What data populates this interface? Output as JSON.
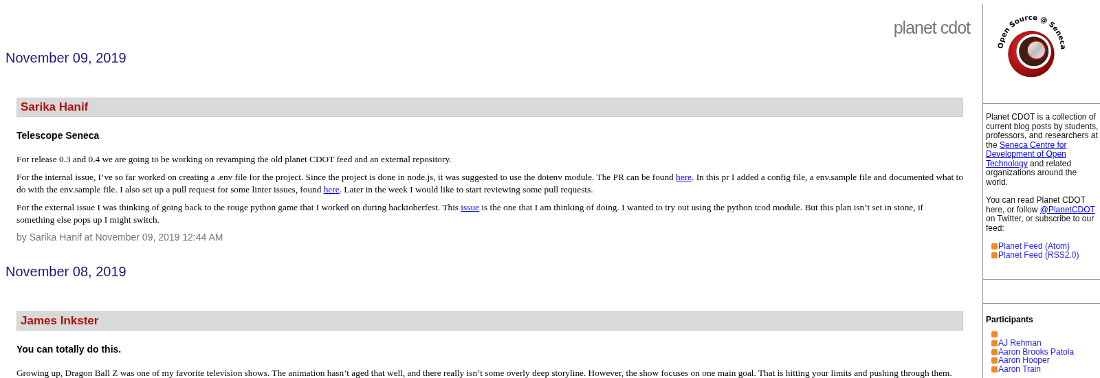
{
  "site_title": "planet cdot",
  "days": [
    {
      "date": "November 09, 2019",
      "posts": [
        {
          "author": "Sarika Hanif",
          "title": "Telescope Seneca",
          "paragraphs": [
            [
              {
                "kind": "text",
                "text": "For release 0.3 and 0.4 we are going to be working on revamping the old planet CDOT feed and an external repository."
              }
            ],
            [
              {
                "kind": "text",
                "text": "For the internal issue, I’ve so far worked on creating a .env file for the project. Since the project is done in node.js, it was suggested to use the dotenv module. The PR can be found "
              },
              {
                "kind": "link",
                "text": "here"
              },
              {
                "kind": "text",
                "text": ". In this pr I added a config file, a env.sample file and documented what to do with the env.sample file. I also set up a pull request for some linter issues, found "
              },
              {
                "kind": "link",
                "text": "here"
              },
              {
                "kind": "text",
                "text": ". Later in the week I would like to start reviewing some pull requests."
              }
            ],
            [
              {
                "kind": "text",
                "text": "For the external issue I was thinking of going back to the rouge python game that I worked on during hacktoberfest. This "
              },
              {
                "kind": "link",
                "text": "issue"
              },
              {
                "kind": "text",
                "text": " is the one that I am thinking of doing. I wanted to try out using the python tcod module. But this plan isn’t set in stone, if something else pops up I might switch."
              }
            ]
          ],
          "byline": "by Sarika Hanif at November 09, 2019 12:44 AM"
        }
      ]
    },
    {
      "date": "November 08, 2019",
      "posts": [
        {
          "author": "James Inkster",
          "title": "You can totally do this.",
          "paragraphs": [
            [
              {
                "kind": "text",
                "text": "Growing up, Dragon Ball Z was one of my favorite television shows. The animation hasn’t aged that well, and there really isn’t some overly deep storyline. However, the show focuses on one main goal. That is hitting your limits and pushing through them."
              }
            ]
          ]
        }
      ]
    }
  ],
  "sidebar": {
    "logo_text": "Open Source @ Seneca",
    "about": [
      {
        "kind": "text",
        "text": "Planet CDOT is a collection of current blog posts by students, professors, and researchers at the "
      },
      {
        "kind": "link",
        "lines": [
          "Seneca Centre for",
          "Development of Open",
          "Technology"
        ]
      },
      {
        "kind": "text",
        "text": " and related organizations around the world."
      }
    ],
    "follow": [
      {
        "kind": "text",
        "text": "You can read Planet CDOT here, or follow "
      },
      {
        "kind": "link",
        "text": "@PlanetCDOT"
      },
      {
        "kind": "text",
        "text": " on Twitter, or subscribe to our feed:"
      }
    ],
    "feeds": [
      "Planet Feed (Atom)",
      "Planet Feed (RSS2.0)"
    ],
    "participants_title": "Participants",
    "participants": [
      {
        "kind": "feed"
      },
      {
        "kind": "person",
        "name": "AJ Rehman"
      },
      {
        "kind": "person",
        "name": "Aaron Brooks Patola"
      },
      {
        "kind": "person",
        "name": "Aaron Hooper"
      },
      {
        "kind": "person",
        "name": "Aaron Train"
      }
    ]
  }
}
